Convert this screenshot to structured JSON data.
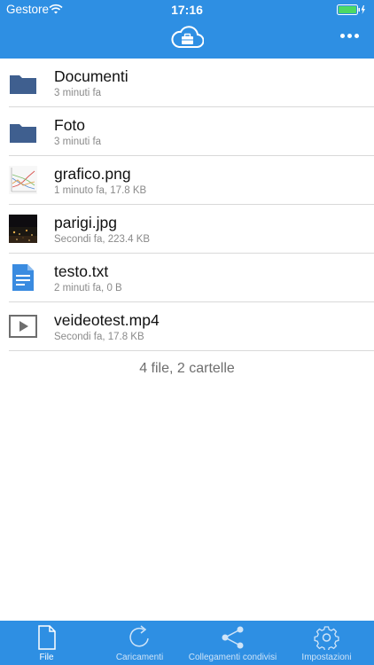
{
  "status_bar": {
    "carrier": "Gestore",
    "time": "17:16"
  },
  "header": {
    "logo_icon": "cloud-briefcase-icon",
    "more_icon": "more-dots-icon"
  },
  "files": [
    {
      "name": "Documenti",
      "meta": "3 minuti fa",
      "icon": "folder-icon"
    },
    {
      "name": "Foto",
      "meta": "3 minuti fa",
      "icon": "folder-icon"
    },
    {
      "name": "grafico.png",
      "meta": "1 minuto fa, 17.8 KB",
      "icon": "chart-thumbnail"
    },
    {
      "name": "parigi.jpg",
      "meta": "Secondi fa, 223.4 KB",
      "icon": "photo-thumbnail"
    },
    {
      "name": "testo.txt",
      "meta": "2 minuti fa, 0 B",
      "icon": "text-file-icon"
    },
    {
      "name": "veideotest.mp4",
      "meta": "Secondi fa, 17.8 KB",
      "icon": "video-file-icon"
    }
  ],
  "summary": "4 file, 2 cartelle",
  "tabs": [
    {
      "label": "File",
      "icon": "file-icon",
      "active": true
    },
    {
      "label": "Caricamenti",
      "icon": "refresh-icon",
      "active": false
    },
    {
      "label": "Collegamenti condivisi",
      "icon": "share-icon",
      "active": false
    },
    {
      "label": "Impostazioni",
      "icon": "gear-icon",
      "active": false
    }
  ],
  "colors": {
    "accent": "#2e8fe3",
    "folder": "#3f5f8f",
    "text_file": "#3a8be0"
  }
}
